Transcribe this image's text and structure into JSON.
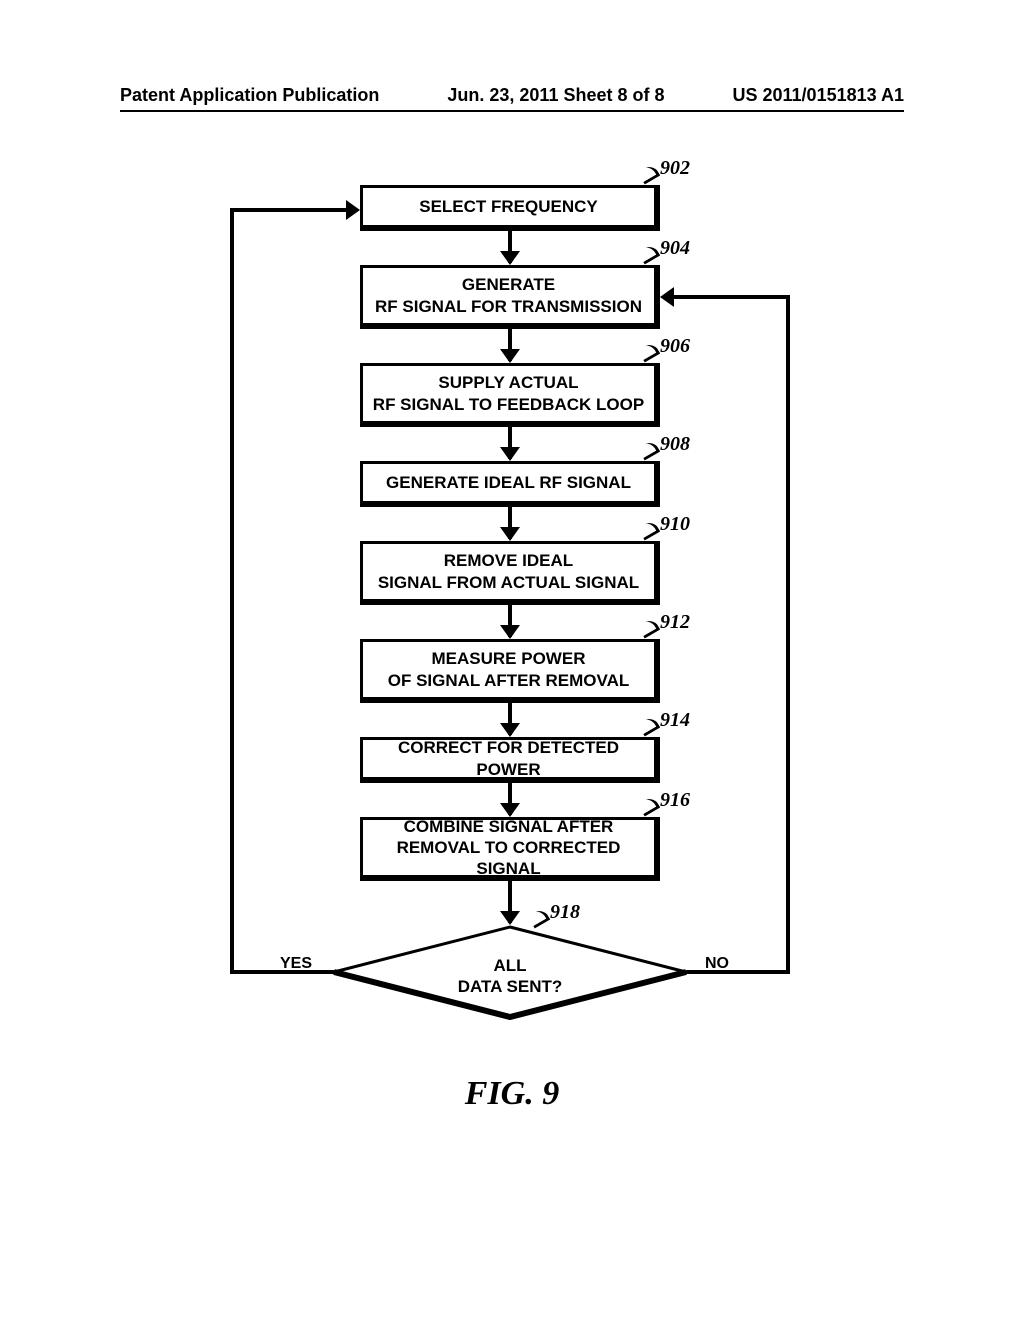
{
  "header": {
    "left": "Patent Application Publication",
    "center": "Jun. 23, 2011  Sheet 8 of 8",
    "right": "US 2011/0151813 A1"
  },
  "steps": [
    {
      "ref": "902",
      "label": "SELECT FREQUENCY",
      "lines": 1
    },
    {
      "ref": "904",
      "label": "GENERATE\nRF SIGNAL FOR TRANSMISSION",
      "lines": 2
    },
    {
      "ref": "906",
      "label": "SUPPLY ACTUAL\nRF SIGNAL TO FEEDBACK LOOP",
      "lines": 2
    },
    {
      "ref": "908",
      "label": "GENERATE IDEAL RF SIGNAL",
      "lines": 1
    },
    {
      "ref": "910",
      "label": "REMOVE IDEAL\nSIGNAL FROM ACTUAL SIGNAL",
      "lines": 2
    },
    {
      "ref": "912",
      "label": "MEASURE POWER\nOF SIGNAL AFTER REMOVAL",
      "lines": 2
    },
    {
      "ref": "914",
      "label": "CORRECT FOR DETECTED POWER",
      "lines": 1
    },
    {
      "ref": "916",
      "label": "COMBINE SIGNAL AFTER\nREMOVAL TO CORRECTED SIGNAL",
      "lines": 2
    }
  ],
  "decision": {
    "ref": "918",
    "label": "ALL\nDATA SENT?",
    "yes": "YES",
    "no": "NO"
  },
  "figure_caption": "FIG. 9",
  "chart_data": {
    "type": "flowchart",
    "nodes": [
      {
        "id": "902",
        "type": "process",
        "text": "SELECT FREQUENCY"
      },
      {
        "id": "904",
        "type": "process",
        "text": "GENERATE RF SIGNAL FOR TRANSMISSION"
      },
      {
        "id": "906",
        "type": "process",
        "text": "SUPPLY ACTUAL RF SIGNAL TO FEEDBACK LOOP"
      },
      {
        "id": "908",
        "type": "process",
        "text": "GENERATE IDEAL RF SIGNAL"
      },
      {
        "id": "910",
        "type": "process",
        "text": "REMOVE IDEAL SIGNAL FROM ACTUAL SIGNAL"
      },
      {
        "id": "912",
        "type": "process",
        "text": "MEASURE POWER OF SIGNAL AFTER REMOVAL"
      },
      {
        "id": "914",
        "type": "process",
        "text": "CORRECT FOR DETECTED POWER"
      },
      {
        "id": "916",
        "type": "process",
        "text": "COMBINE SIGNAL AFTER REMOVAL TO CORRECTED SIGNAL"
      },
      {
        "id": "918",
        "type": "decision",
        "text": "ALL DATA SENT?"
      }
    ],
    "edges": [
      {
        "from": "902",
        "to": "904"
      },
      {
        "from": "904",
        "to": "906"
      },
      {
        "from": "906",
        "to": "908"
      },
      {
        "from": "908",
        "to": "910"
      },
      {
        "from": "910",
        "to": "912"
      },
      {
        "from": "912",
        "to": "914"
      },
      {
        "from": "914",
        "to": "916"
      },
      {
        "from": "916",
        "to": "918"
      },
      {
        "from": "918",
        "to": "902",
        "label": "YES"
      },
      {
        "from": "918",
        "to": "904",
        "label": "NO"
      }
    ],
    "title": "FIG. 9"
  }
}
